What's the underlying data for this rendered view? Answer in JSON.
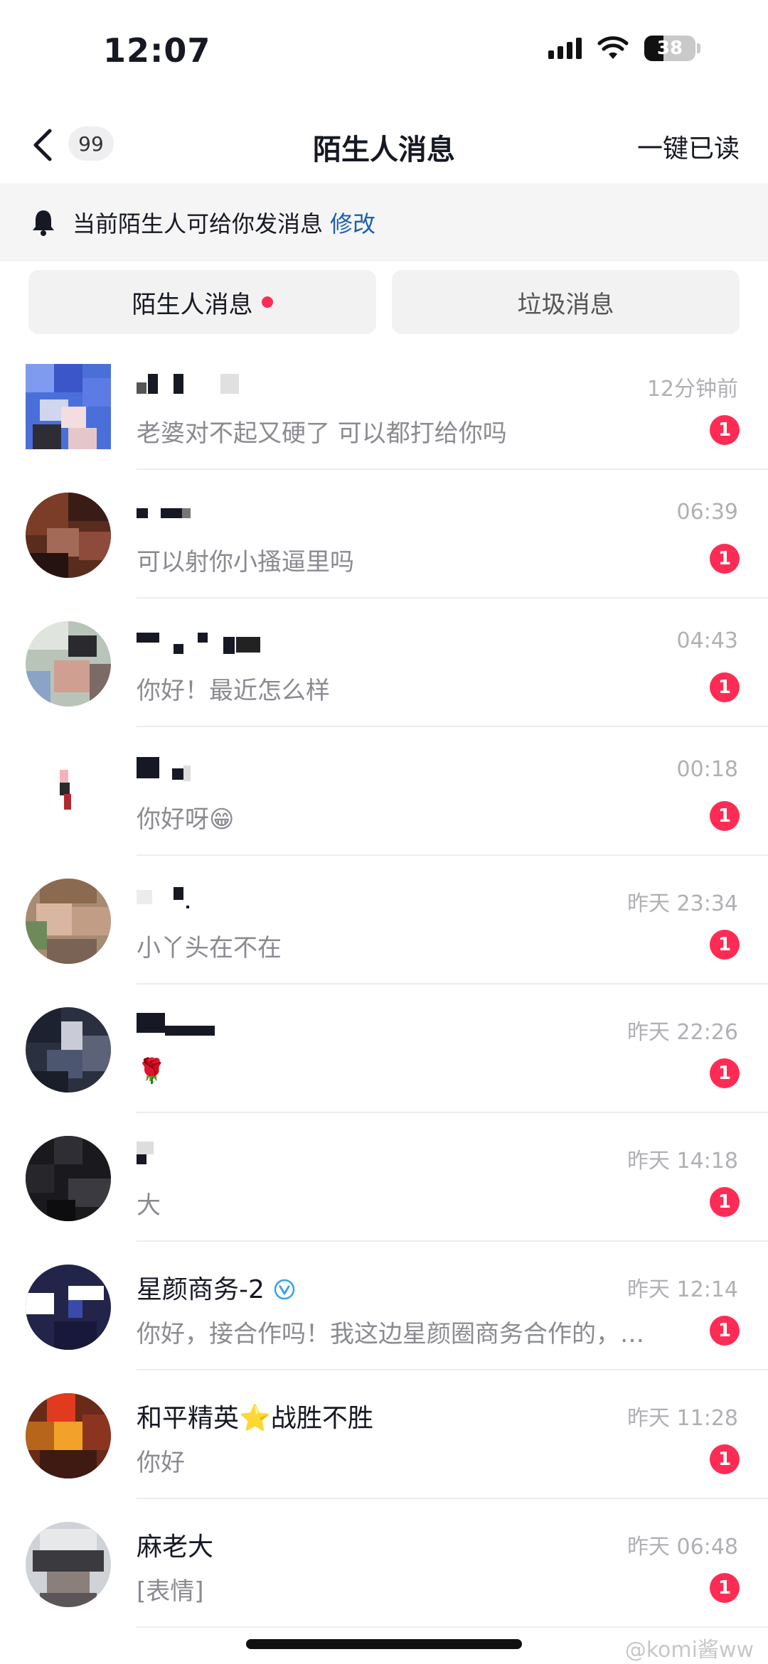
{
  "status_bar": {
    "time": "12:07",
    "battery": "38"
  },
  "nav": {
    "unread_count": "99",
    "title": "陌生人消息",
    "action": "一键已读"
  },
  "notice": {
    "text": "当前陌生人可给你发消息",
    "link": "修改"
  },
  "tabs": [
    {
      "label": "陌生人消息",
      "has_dot": true
    },
    {
      "label": "垃圾消息",
      "has_dot": false
    }
  ],
  "colors": {
    "accent_red": "#fe2c55",
    "link_blue": "#1d5fb4"
  },
  "conversations": [
    {
      "name": "",
      "time": "12分钟前",
      "message": "老婆对不起又硬了 可以都打给你吗",
      "unread": "1"
    },
    {
      "name": "",
      "time": "06:39",
      "message": "可以射你小搔逼里吗",
      "unread": "1"
    },
    {
      "name": "",
      "time": "04:43",
      "message": "你好！最近怎么样",
      "unread": "1"
    },
    {
      "name": "",
      "time": "00:18",
      "message": "你好呀😁",
      "unread": "1"
    },
    {
      "name": "",
      "time": "昨天 23:34",
      "message": "小丫头在不在",
      "unread": "1"
    },
    {
      "name": "",
      "time": "昨天 22:26",
      "message": "🌹",
      "unread": "1"
    },
    {
      "name": "",
      "time": "昨天 14:18",
      "message": "大",
      "unread": "1"
    },
    {
      "name": "星颜商务-2",
      "time": "昨天 12:14",
      "message": "你好，接合作吗！我这边星颜圈商务合作的，…",
      "unread": "1",
      "verified": true
    },
    {
      "name": "和平精英⭐战胜不胜",
      "time": "昨天 11:28",
      "message": "你好",
      "unread": "1"
    },
    {
      "name": "麻老大",
      "time": "昨天 06:48",
      "message": "[表情]",
      "unread": "1"
    }
  ],
  "watermark": "@komi酱ww"
}
